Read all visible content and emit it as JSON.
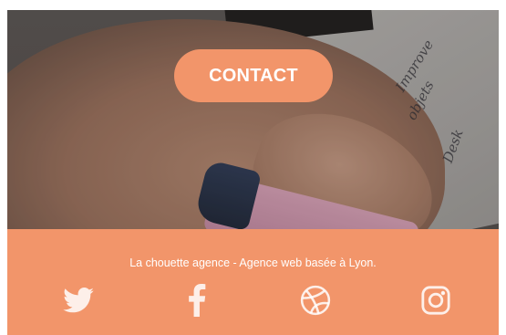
{
  "hero": {
    "contact_label": "CONTACT",
    "image_description": "hand-icon",
    "scribbles": [
      "Improve",
      "objets",
      "Desk"
    ]
  },
  "footer": {
    "tagline": "La chouette agence - Agence web basée à Lyon.",
    "social": [
      {
        "name": "twitter",
        "icon": "twitter-icon"
      },
      {
        "name": "facebook",
        "icon": "facebook-icon"
      },
      {
        "name": "dribbble",
        "icon": "dribbble-icon"
      },
      {
        "name": "instagram",
        "icon": "instagram-icon"
      }
    ]
  },
  "colors": {
    "accent": "#f2956a",
    "text_light": "#ffffff"
  }
}
